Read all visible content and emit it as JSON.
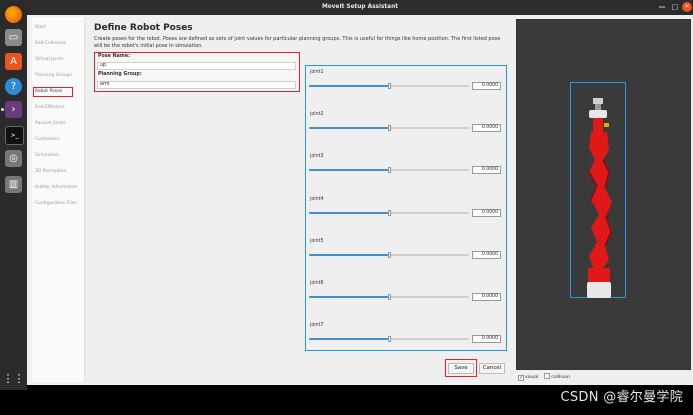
{
  "window": {
    "title": "MoveIt Setup Assistant"
  },
  "sidebar": {
    "items": [
      {
        "label": "Start"
      },
      {
        "label": "Self-Collisions"
      },
      {
        "label": "Virtual Joints"
      },
      {
        "label": "Planning Groups"
      },
      {
        "label": "Robot Poses",
        "active": true
      },
      {
        "label": "End Effectors"
      },
      {
        "label": "Passive Joints"
      },
      {
        "label": "Controllers"
      },
      {
        "label": "Simulation"
      },
      {
        "label": "3D Perception"
      },
      {
        "label": "Author Information"
      },
      {
        "label": "Configuration Files"
      }
    ]
  },
  "main": {
    "heading": "Define Robot Poses",
    "description": "Create poses for the robot. Poses are defined as sets of joint values for particular planning groups. This is useful for things like home position. The first listed pose will be the robot's initial pose in simulation.",
    "pose_name_label": "Pose Name:",
    "pose_name_value": "up",
    "planning_group_label": "Planning Group:",
    "planning_group_value": "arm",
    "joints": [
      {
        "name": "joint1",
        "value": "0.0000",
        "fraction": 0.5
      },
      {
        "name": "joint2",
        "value": "0.0000",
        "fraction": 0.5
      },
      {
        "name": "joint3",
        "value": "0.0000",
        "fraction": 0.5
      },
      {
        "name": "joint4",
        "value": "0.0000",
        "fraction": 0.5
      },
      {
        "name": "joint5",
        "value": "0.0000",
        "fraction": 0.5
      },
      {
        "name": "joint6",
        "value": "0.0000",
        "fraction": 0.5
      },
      {
        "name": "joint7",
        "value": "0.0000",
        "fraction": 0.5
      }
    ],
    "save_label": "Save",
    "cancel_label": "Cancel"
  },
  "viewer": {
    "visual_label": "visual",
    "visual_checked": true,
    "collision_label": "collision",
    "collision_checked": false
  },
  "watermark": "CSDN @睿尔曼学院",
  "colors": {
    "accent": "#1e9be0",
    "highlight": "#e0202c",
    "robot": "#e01818",
    "dock": "#2b2b2b"
  }
}
